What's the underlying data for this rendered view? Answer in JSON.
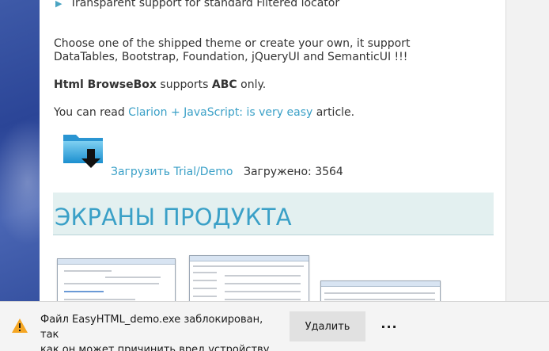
{
  "content": {
    "feature_line": "Transparent support for standard Filtered locator",
    "paragraph1_line1": "Choose one of the shipped theme or create your own, it support",
    "paragraph1_line2": "DataTables, Bootstrap, Foundation, jQueryUI and SemanticUI !!!",
    "paragraph2": {
      "part1": "Html BrowseBox",
      "part2": " supports ",
      "part3": "ABC",
      "part4": " only."
    },
    "paragraph3": {
      "before": "You can read ",
      "link": "Clarion + JavaScript: is very easy",
      "after": " article."
    },
    "download": {
      "icon": "folder-download-icon",
      "link_label": "Загрузить Trial/Demo",
      "count_text": "Загружено: 3564"
    },
    "section_title": "ЭКРАНЫ ПРОДУКТА"
  },
  "notification": {
    "icon": "warning-icon",
    "text_line1": "Файл EasyHTML_demo.exe заблокирован, так",
    "text_line2": "как он может причинить вред устройству.",
    "delete_label": "Удалить",
    "more_label": "···"
  },
  "colors": {
    "link": "#3aa0c7",
    "section_bg": "#e3f0f0",
    "warning": "#f5a623",
    "side_blue": "#2b4597"
  }
}
